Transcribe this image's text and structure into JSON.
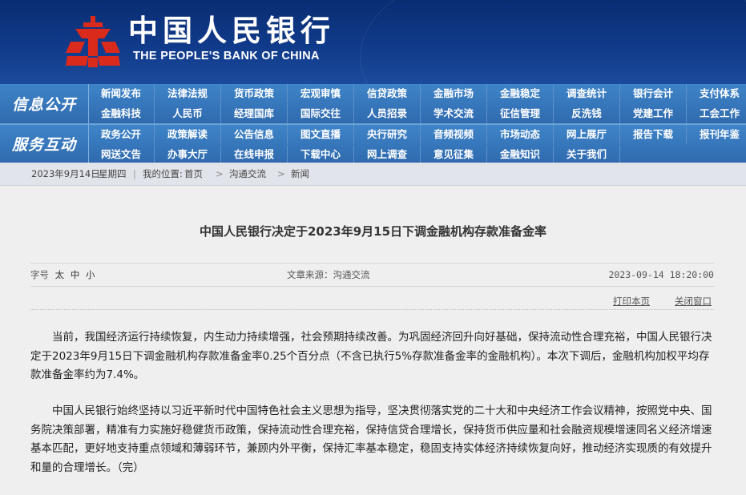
{
  "header": {
    "bank_name_cn": "中国人民银行",
    "bank_name_en": "THE PEOPLE'S BANK OF CHINA",
    "logo_icon": "pboc-emblem-icon",
    "colors": {
      "header_bg": "#0a2d72",
      "logo": "#d92a1c",
      "nav_bg": "#3a78be"
    }
  },
  "nav": {
    "section1_title": "信息公开",
    "section1_items": [
      "新闻发布",
      "法律法规",
      "货币政策",
      "宏观审慎",
      "信贷政策",
      "金融市场",
      "金融稳定",
      "调查统计",
      "银行会计",
      "支付体系",
      "金融科技",
      "人民币",
      "经理国库",
      "国际交往",
      "人员招录",
      "学术交流",
      "征信管理",
      "反洗钱",
      "党建工作",
      "工会工作"
    ],
    "section2_title": "服务互动",
    "section2_items": [
      "政务公开",
      "政策解读",
      "公告信息",
      "图文直播",
      "央行研究",
      "音频视频",
      "市场动态",
      "网上展厅",
      "报告下载",
      "报刊年鉴",
      "网送文告",
      "办事大厅",
      "在线申报",
      "下载中心",
      "网上调查",
      "意见征集",
      "金融知识",
      "关于我们"
    ]
  },
  "breadcrumb": {
    "date": "2023年9月14日",
    "weekday": "星期四",
    "location_label": "我的位置:",
    "home": "首页",
    "sep": ">",
    "level1": "沟通交流",
    "level2": "新闻"
  },
  "article": {
    "title": "中国人民银行决定于2023年9月15日下调金融机构存款准备金率",
    "font_size_label": "字号",
    "font_sizes": [
      "太",
      "中",
      "小"
    ],
    "source": "文章来源：沟通交流",
    "datetime": "2023-09-14  18:20:00",
    "print_label": "打印本页",
    "close_label": "关闭窗口",
    "paragraphs": [
      "当前，我国经济运行持续恢复，内生动力持续增强，社会预期持续改善。为巩固经济回升向好基础，保持流动性合理充裕，中国人民银行决定于2023年9月15日下调金融机构存款准备金率0.25个百分点（不含已执行5%存款准备金率的金融机构）。本次下调后，金融机构加权平均存款准备金率约为7.4%。",
      "中国人民银行始终坚持以习近平新时代中国特色社会主义思想为指导，坚决贯彻落实党的二十大和中央经济工作会议精神，按照党中央、国务院决策部署，精准有力实施好稳健货币政策，保持流动性合理充裕，保持信贷合理增长，保持货币供应量和社会融资规模增速同名义经济增速基本匹配，更好地支持重点领域和薄弱环节，兼顾内外平衡，保持汇率基本稳定，稳固支持实体经济持续恢复向好，推动经济实现质的有效提升和量的合理增长。（完）"
    ]
  }
}
